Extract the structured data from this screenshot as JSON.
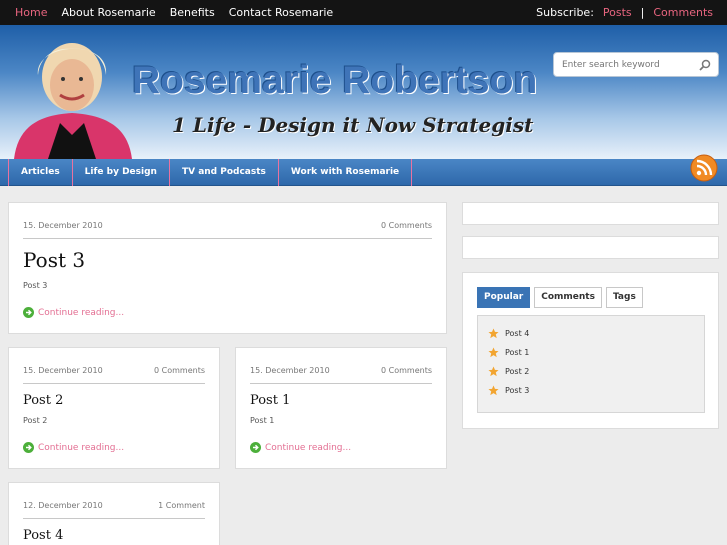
{
  "topbar": {
    "nav": [
      "Home",
      "About Rosemarie",
      "Benefits",
      "Contact Rosemarie"
    ],
    "subscribe_label": "Subscribe:",
    "posts_label": "Posts",
    "separator": "|",
    "comments_label": "Comments"
  },
  "header": {
    "site_title": "Rosemarie Robertson",
    "tagline": "1 Life - Design it Now Strategist",
    "search_placeholder": "Enter search keyword"
  },
  "mainnav": [
    "Articles",
    "Life by Design",
    "TV and Podcasts",
    "Work with Rosemarie"
  ],
  "posts": [
    {
      "date": "15. December 2010",
      "comments": "0 Comments",
      "title": "Post 3",
      "excerpt": "Post 3",
      "more": "Continue reading..."
    },
    {
      "date": "15. December 2010",
      "comments": "0 Comments",
      "title": "Post 2",
      "excerpt": "Post 2",
      "more": "Continue reading..."
    },
    {
      "date": "15. December 2010",
      "comments": "0 Comments",
      "title": "Post 1",
      "excerpt": "Post 1",
      "more": "Continue reading..."
    },
    {
      "date": "12. December 2010",
      "comments": "1 Comment",
      "title": "Post 4"
    }
  ],
  "sidebar": {
    "tabs": [
      "Popular",
      "Comments",
      "Tags"
    ],
    "active_tab": "Popular",
    "popular": [
      "Post 4",
      "Post 1",
      "Post 2",
      "Post 3"
    ]
  },
  "colors": {
    "accent_pink": "#e8657f",
    "nav_blue": "#3a74b5",
    "link_pink": "#e36f93"
  }
}
